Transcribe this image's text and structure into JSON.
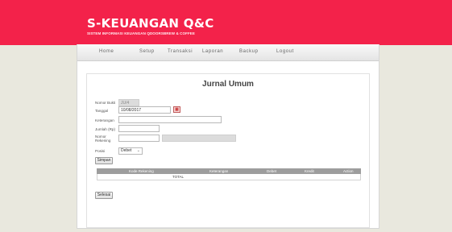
{
  "header": {
    "title": "S-KEUANGAN Q&C",
    "subtitle": "SISTEM INFORMASI KEUANGAN QDOORSBREW & COFFEE",
    "bg_color": "#f3224a"
  },
  "nav": {
    "items": [
      "Home",
      "Setup",
      "Transaksi",
      "Laporan",
      "Backup",
      "Logout"
    ]
  },
  "page": {
    "title": "Jurnal Umum"
  },
  "form": {
    "nomor_bukti": {
      "label": "Nomor Bukti",
      "value": "JU/4"
    },
    "tanggal": {
      "label": "Tanggal",
      "value": "10/08/2017"
    },
    "keterangan": {
      "label": "Keterangan",
      "value": ""
    },
    "jumlah": {
      "label": "Jumlah (Rp)",
      "value": ""
    },
    "nomor_rekening": {
      "label_line1": "Nomor",
      "label_line2": "Rekening",
      "value": "",
      "name_value": ""
    },
    "posisi": {
      "label": "Posisi",
      "selected": "Debet",
      "icon": "chevron-down-icon"
    },
    "simpan_label": "Simpan",
    "calendar_icon": "calendar-icon"
  },
  "table": {
    "columns": [
      "Kode Rekening",
      "Keterangan",
      "Debet",
      "Kredit",
      "Action"
    ],
    "total_label": "TOTAL"
  },
  "selesai_label": "Selesai"
}
